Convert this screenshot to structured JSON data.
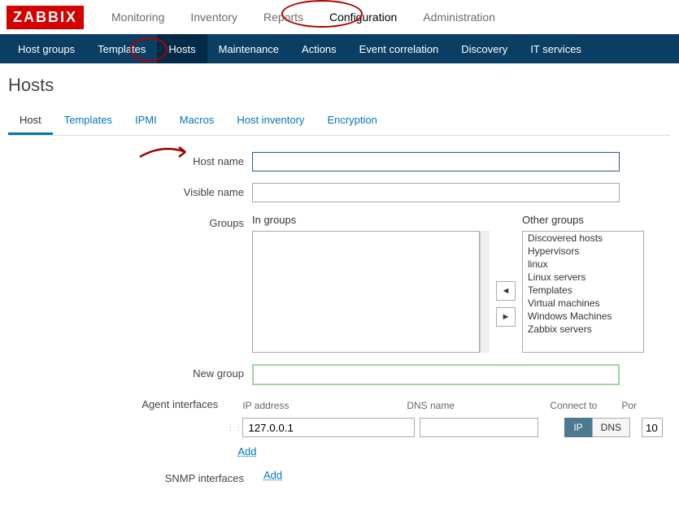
{
  "logo": "ZABBIX",
  "topnav": {
    "monitoring": "Monitoring",
    "inventory": "Inventory",
    "reports": "Reports",
    "configuration": "Configuration",
    "administration": "Administration"
  },
  "subnav": {
    "host_groups": "Host groups",
    "templates": "Templates",
    "hosts": "Hosts",
    "maintenance": "Maintenance",
    "actions": "Actions",
    "event_correlation": "Event correlation",
    "discovery": "Discovery",
    "it_services": "IT services"
  },
  "page_title": "Hosts",
  "tabs": {
    "host": "Host",
    "templates": "Templates",
    "ipmi": "IPMI",
    "macros": "Macros",
    "host_inventory": "Host inventory",
    "encryption": "Encryption"
  },
  "labels": {
    "host_name": "Host name",
    "visible_name": "Visible name",
    "groups": "Groups",
    "in_groups": "In groups",
    "other_groups": "Other groups",
    "new_group": "New group",
    "agent_interfaces": "Agent interfaces",
    "snmp_interfaces": "SNMP interfaces"
  },
  "other_groups": [
    "Discovered hosts",
    "Hypervisors",
    "linux",
    "Linux servers",
    "Templates",
    "Virtual machines",
    "Windows Machines",
    "Zabbix servers"
  ],
  "iface_headers": {
    "ip": "IP address",
    "dns": "DNS name",
    "connect": "Connect to",
    "port": "Por"
  },
  "iface_row": {
    "ip": "127.0.0.1",
    "dns": "",
    "toggle_ip": "IP",
    "toggle_dns": "DNS",
    "port": "10"
  },
  "links": {
    "add": "Add"
  },
  "move_left": "◄",
  "move_right": "►"
}
